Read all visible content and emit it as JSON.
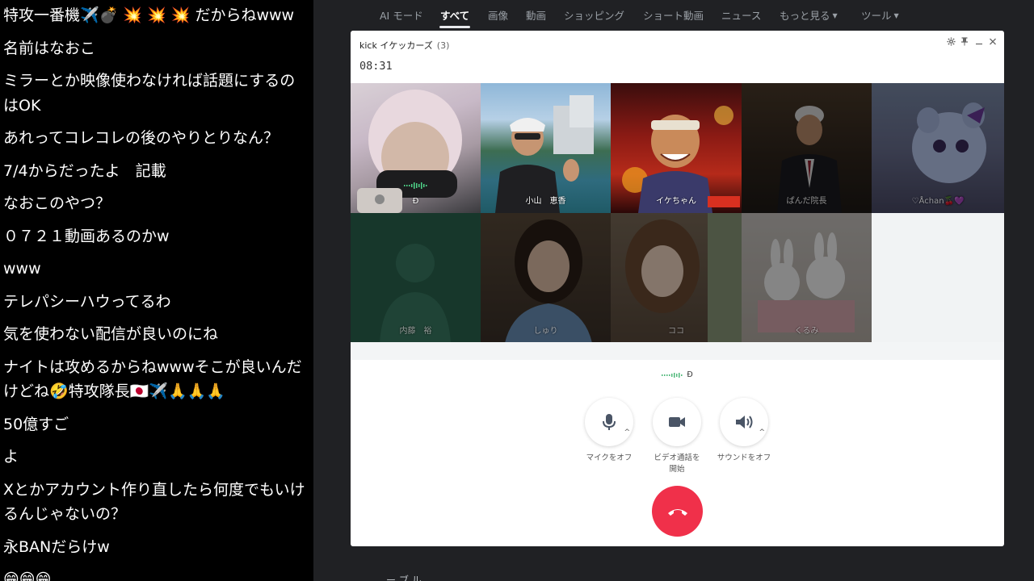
{
  "chat": {
    "messages": [
      "特攻一番機✈️💣 💥 💥 💥 だからねwww",
      "名前はなおこ",
      "ミラーとか映像使わなければ話題にするのはOK",
      "あれってコレコレの後のやりとりなん？",
      "7/4からだったよ　記載",
      "なおこのやつ？",
      "０７２１動画あるのかw",
      "www",
      "テレパシーハウってるわ",
      "気を使わない配信が良いのにね",
      "ナイトは攻めるからねwwwそこが良いんだけどね🤣特攻隊長🇯🇵✈️🙏🙏🙏",
      "50億すご",
      "よ",
      "Xとかアカウント作り直したら何度でもいけるんじゃないの？",
      "永BANだらけw",
      "😁😁😁"
    ]
  },
  "search_tabs": {
    "items": [
      "AI モード",
      "すべて",
      "画像",
      "動画",
      "ショッピング",
      "ショート動画",
      "ニュース",
      "もっと見る",
      "ツール"
    ],
    "active_index": 1
  },
  "call": {
    "title": "kick イケッカーズ",
    "participant_count": "(3)",
    "timer": "08:31",
    "window_controls": [
      "⚙",
      "📌",
      "−",
      "✕"
    ],
    "participants": [
      {
        "name": "Ð",
        "active": true,
        "speaking": true
      },
      {
        "name": "小山　恵香",
        "active": true
      },
      {
        "name": "イケちゃん",
        "active": true
      },
      {
        "name": "ぱんだ院長",
        "active": false
      },
      {
        "name": "♡Åchan🍒💜",
        "active": false
      },
      {
        "name": "内藤　裕",
        "active": false
      },
      {
        "name": "しゅり",
        "active": false
      },
      {
        "name": "ココ",
        "active": false
      },
      {
        "name": "くるみ",
        "active": false
      }
    ],
    "speaking_name": "Ð",
    "controls": {
      "mic_label": "マイクをオフ",
      "video_label": "ビデオ通話を開始",
      "sound_label": "サウンドをオフ"
    }
  },
  "bottom_snippet": "ー ブ ル",
  "colors": {
    "end_call": "#f0304a",
    "browser_bg": "#202124"
  }
}
